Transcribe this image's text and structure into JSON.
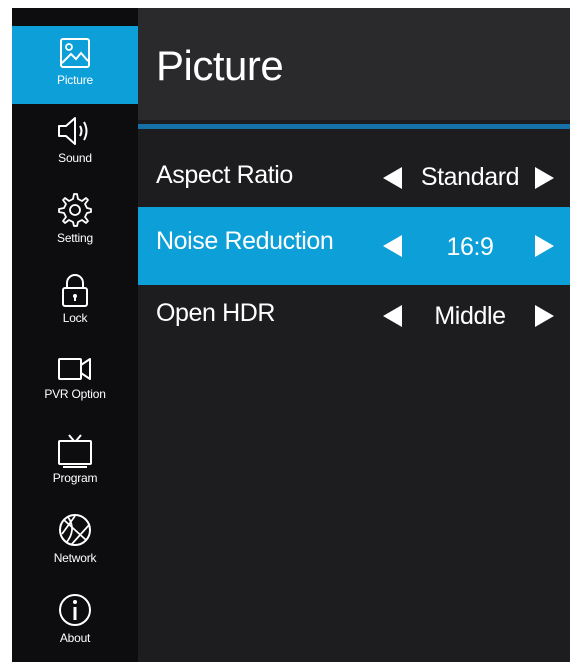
{
  "sidebar": {
    "items": [
      {
        "label": "Picture",
        "icon": "picture-icon",
        "active": true
      },
      {
        "label": "Sound",
        "icon": "speaker-icon"
      },
      {
        "label": "Setting",
        "icon": "gear-icon"
      },
      {
        "label": "Lock",
        "icon": "lock-icon"
      },
      {
        "label": "PVR Option",
        "icon": "video-camera-icon"
      },
      {
        "label": "Program",
        "icon": "tv-icon"
      },
      {
        "label": "Network",
        "icon": "globe-icon"
      },
      {
        "label": "About",
        "icon": "info-icon"
      }
    ]
  },
  "main": {
    "title": "Picture",
    "rows": [
      {
        "label": "Aspect Ratio",
        "value": "Standard"
      },
      {
        "label": "Noise Reduction",
        "value": "16:9",
        "highlighted": true
      },
      {
        "label": "Open HDR",
        "value": "Middle"
      }
    ]
  },
  "colors": {
    "accent": "#0d9fd8",
    "divider": "#1571a8",
    "sidebar_bg": "#0d0d0f",
    "main_bg": "#1d1d20",
    "header_bg": "#2a2a2d"
  }
}
